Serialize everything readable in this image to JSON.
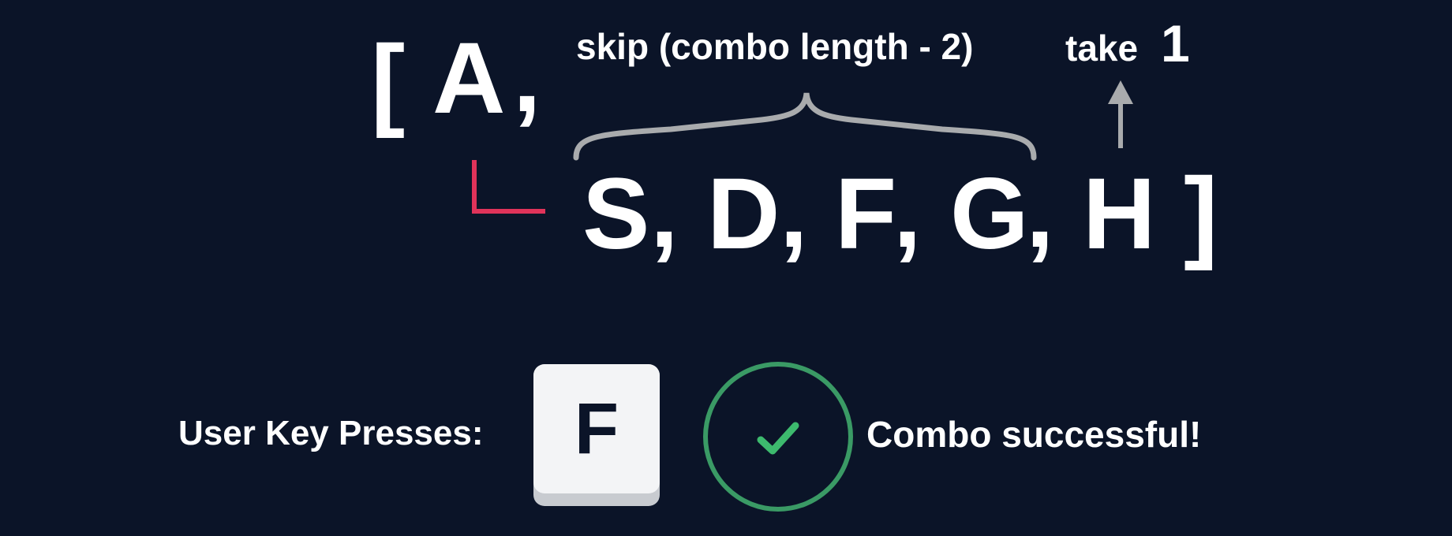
{
  "sequence": {
    "open_bracket": "[",
    "first_key": "A",
    "remaining_keys": [
      "S",
      "D",
      "F",
      "G",
      "H"
    ],
    "separator": ",",
    "close_bracket": "]"
  },
  "annotations": {
    "skip_label": "skip (combo length - 2)",
    "take_label": "take",
    "take_count": "1"
  },
  "footer": {
    "key_presses_label": "User Key Presses:",
    "pressed_key": "F",
    "status_text": "Combo successful!"
  },
  "colors": {
    "background": "#0b1428",
    "text": "#ffffff",
    "brace": "#a9abad",
    "arrow": "#a9abad",
    "elbow": "#e0335a",
    "success": "#3a9a65",
    "keycap": "#f3f4f6"
  },
  "icons": {
    "elbow_connector": "elbow-connector-icon",
    "up_arrow": "arrow-up-icon",
    "success_check": "checkmark-circle-icon"
  }
}
